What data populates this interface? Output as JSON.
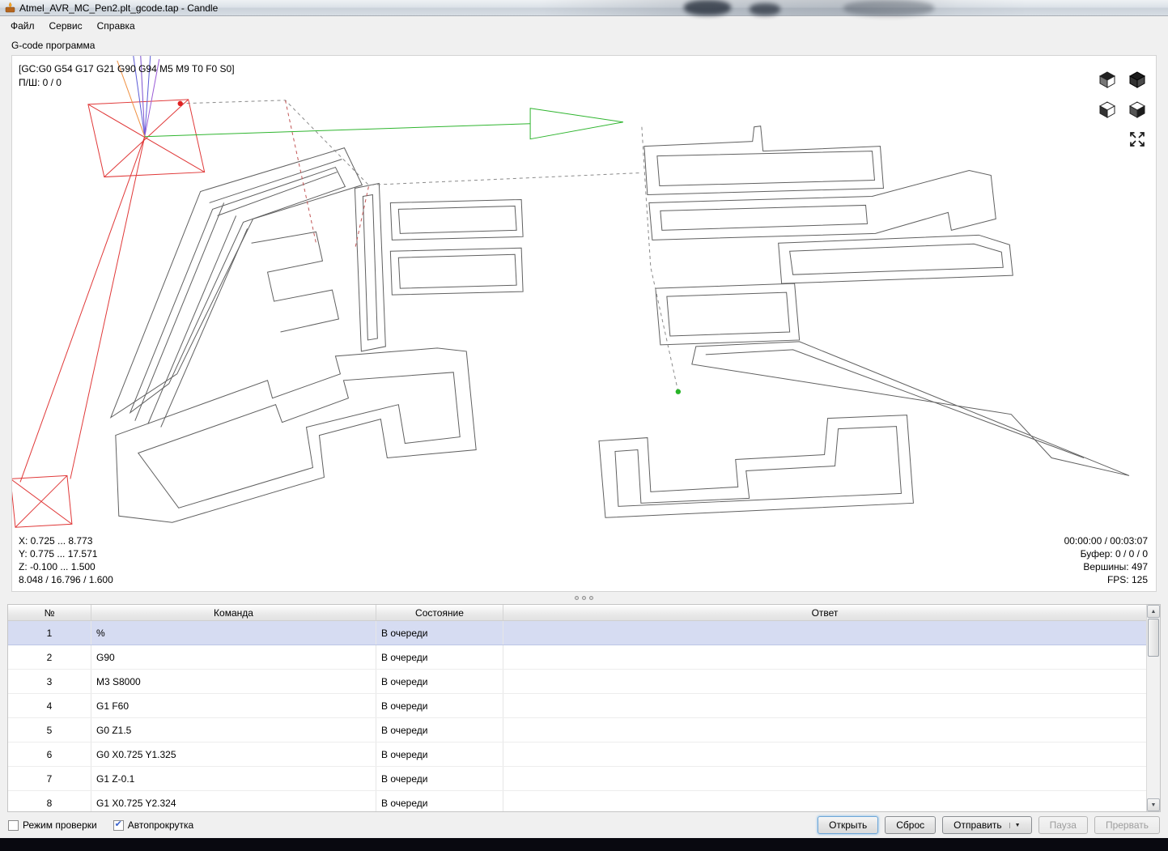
{
  "window": {
    "title": "Atmel_AVR_MC_Pen2.plt_gcode.tap - Candle"
  },
  "menu": {
    "items": [
      {
        "label": "Файл"
      },
      {
        "label": "Сервис"
      },
      {
        "label": "Справка"
      }
    ]
  },
  "group": {
    "title": "G-code программа"
  },
  "visualizer": {
    "parser_state": "[GC:G0 G54 G17 G21 G90 G94 M5 M9 T0 F0 S0]",
    "steps": "П/Ш: 0 / 0",
    "bounds": {
      "x": "X: 0.725 ... 8.773",
      "y": "Y: 0.775 ... 17.571",
      "z": "Z: -0.100 ... 1.500",
      "size": "8.048 / 16.796 / 1.600"
    },
    "stats": {
      "time": "00:00:00 / 00:03:07",
      "buffer": "Буфер: 0 / 0 / 0",
      "vertices": "Вершины: 497",
      "fps": "FPS: 125"
    }
  },
  "table": {
    "headers": {
      "num": "№",
      "command": "Команда",
      "state": "Состояние",
      "response": "Ответ"
    },
    "rows": [
      {
        "num": "1",
        "command": "%",
        "state": "В очереди",
        "response": ""
      },
      {
        "num": "2",
        "command": "G90",
        "state": "В очереди",
        "response": ""
      },
      {
        "num": "3",
        "command": "M3 S8000",
        "state": "В очереди",
        "response": ""
      },
      {
        "num": "4",
        "command": "G1 F60",
        "state": "В очереди",
        "response": ""
      },
      {
        "num": "5",
        "command": "G0 Z1.5",
        "state": "В очереди",
        "response": ""
      },
      {
        "num": "6",
        "command": "G0 X0.725 Y1.325",
        "state": "В очереди",
        "response": ""
      },
      {
        "num": "7",
        "command": "G1 Z-0.1",
        "state": "В очереди",
        "response": ""
      },
      {
        "num": "8",
        "command": "G1 X0.725 Y2.324",
        "state": "В очереди",
        "response": ""
      }
    ]
  },
  "controls": {
    "check_mode_label": "Режим проверки",
    "autoscroll_label": "Автопрокрутка",
    "buttons": {
      "open": "Открыть",
      "reset": "Сброс",
      "send": "Отправить",
      "pause": "Пауза",
      "abort": "Прервать"
    }
  }
}
